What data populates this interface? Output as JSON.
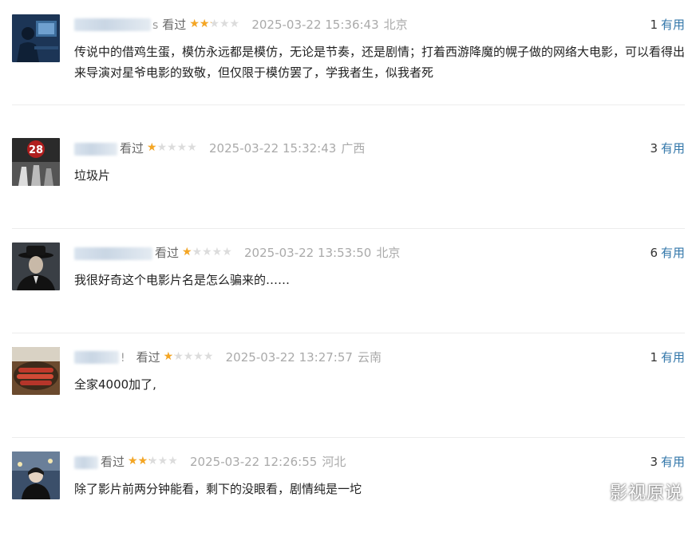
{
  "comments": [
    {
      "username_fragment": "s",
      "watched_label": "看过",
      "rating": 2,
      "time": "2025-03-22 15:36:43",
      "location": "北京",
      "votes": "1",
      "useful_label": "有用",
      "text": "传说中的借鸡生蛋，模仿永远都是模仿，无论是节奏，还是剧情；打着西游降魔的幌子做的网络大电影，可以看得出来导演对星爷电影的致敬，但仅限于模仿罢了，学我者生，似我者死",
      "avatar_icon": "person-at-computer-avatar"
    },
    {
      "username_fragment": "",
      "watched_label": "看过",
      "rating": 1,
      "time": "2025-03-22 15:32:43",
      "location": "广西",
      "votes": "3",
      "useful_label": "有用",
      "text": "垃圾片",
      "avatar_icon": "poster-28-avatar"
    },
    {
      "username_fragment": "",
      "watched_label": "看过",
      "rating": 1,
      "time": "2025-03-22 13:53:50",
      "location": "北京",
      "votes": "6",
      "useful_label": "有用",
      "text": "我很好奇这个电影片名是怎么骗来的……",
      "avatar_icon": "man-in-hat-avatar"
    },
    {
      "username_fragment": "!",
      "watched_label": "看过",
      "rating": 1,
      "time": "2025-03-22 13:27:57",
      "location": "云南",
      "votes": "1",
      "useful_label": "有用",
      "text": "全家4000加了,",
      "avatar_icon": "food-avatar"
    },
    {
      "username_fragment": "",
      "watched_label": "看过",
      "rating": 2,
      "time": "2025-03-22 12:26:55",
      "location": "河北",
      "votes": "3",
      "useful_label": "有用",
      "text": "除了影片前两分钟能看，剩下的没眼看，剧情纯是一坨",
      "avatar_icon": "night-portrait-avatar"
    }
  ],
  "watermark": "影视原说",
  "colors": {
    "star": "#f5a623",
    "link": "#3377aa",
    "meta": "#aaaaaa"
  }
}
